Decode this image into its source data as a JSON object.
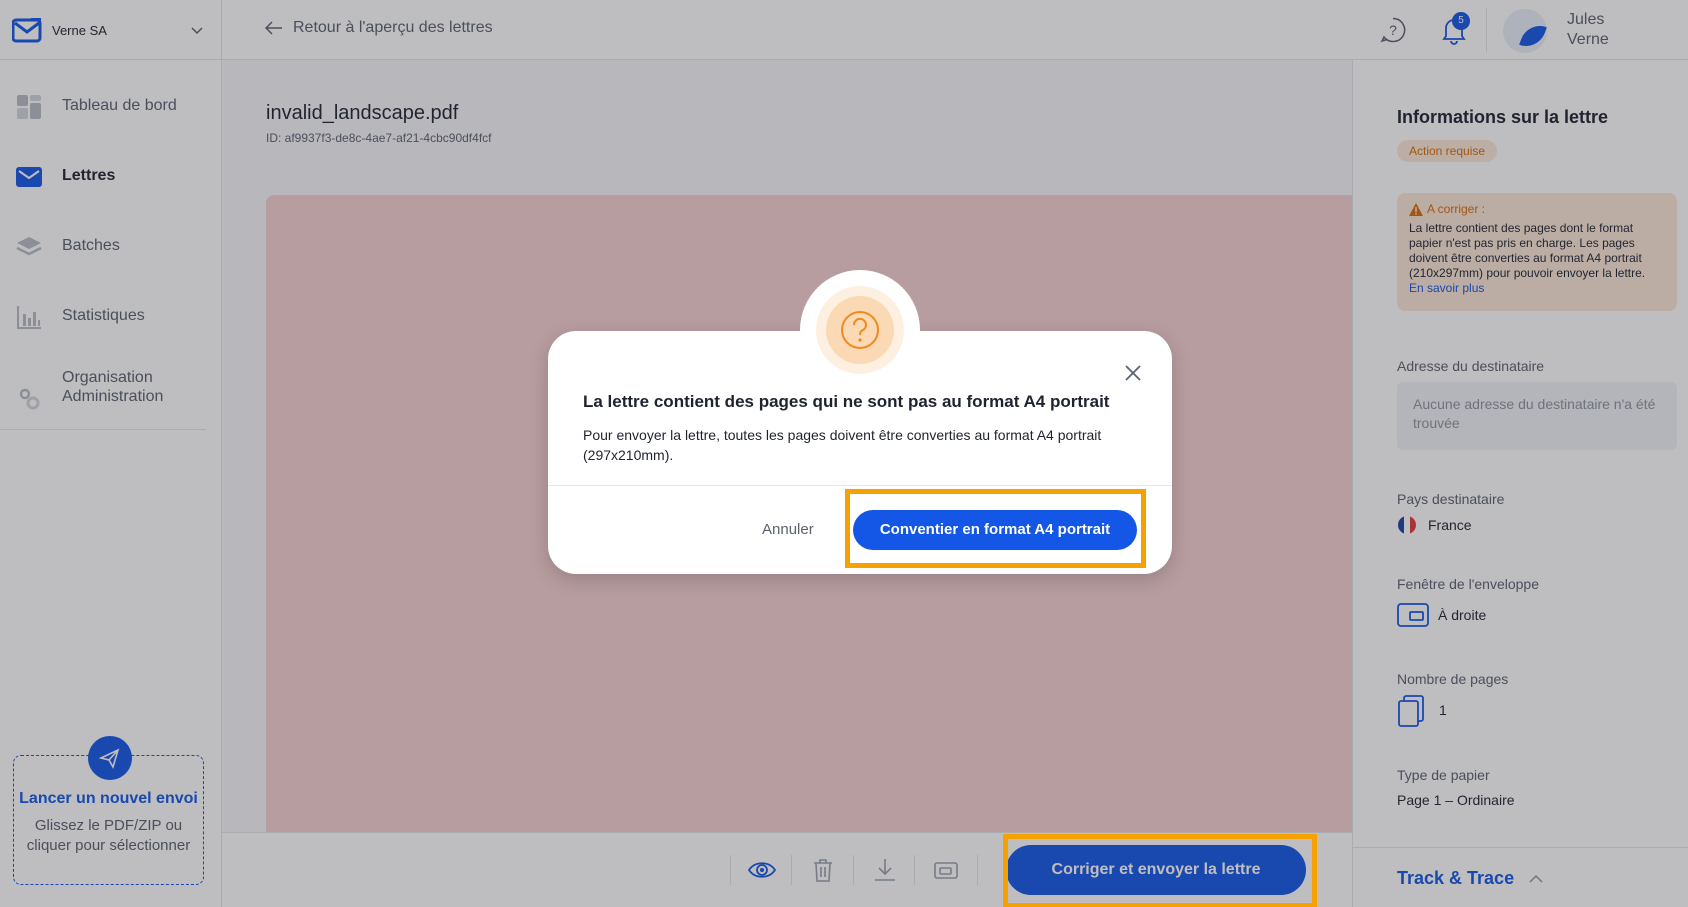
{
  "header": {
    "org_name": "Verne SA",
    "back_label": "Retour à l'aperçu des lettres",
    "notification_count": "5",
    "user_first": "Jules",
    "user_last": "Verne"
  },
  "sidebar": {
    "items": [
      {
        "label": "Tableau de bord",
        "icon": "dashboard-icon"
      },
      {
        "label": "Lettres",
        "icon": "envelope-icon"
      },
      {
        "label": "Batches",
        "icon": "layers-icon"
      },
      {
        "label": "Statistiques",
        "icon": "bar-chart-icon"
      }
    ],
    "admin_line1": "Organisation",
    "admin_line2": "Administration",
    "upload_title": "Lancer un nouvel envoi",
    "upload_sub": "Glissez le PDF/ZIP ou cliquer pour sélectionner"
  },
  "document": {
    "filename": "invalid_landscape.pdf",
    "id": "ID: af9937f3-de8c-4ae7-af21-4cbc90df4fcf"
  },
  "toolbar": {
    "primary_label": "Corriger et envoyer la lettre"
  },
  "info_panel": {
    "title": "Informations sur la lettre",
    "status": "Action requise",
    "warn_title": "A corriger :",
    "warn_text": "La lettre contient des pages dont le format papier n'est pas pris en charge. Les pages doivent être converties au format A4 portrait (210x297mm) pour pouvoir envoyer la lettre.",
    "warn_link": "En savoir plus",
    "address_label": "Adresse du destinataire",
    "address_value": "Aucune adresse du destinataire n'a été trouvée",
    "country_label": "Pays destinataire",
    "country_value": "France",
    "window_label": "Fenêtre de l'enveloppe",
    "window_value": "À droite",
    "pages_label": "Nombre de pages",
    "pages_value": "1",
    "paper_label": "Type de papier",
    "paper_value": "Page 1 – Ordinaire",
    "track_label": "Track & Trace"
  },
  "modal": {
    "title": "La lettre contient des pages qui ne sont pas au format A4 portrait",
    "text": "Pour envoyer la lettre, toutes les pages doivent être converties au format A4 portrait (297x210mm).",
    "cancel_label": "Annuler",
    "confirm_label": "Conventier en format A4 portrait"
  },
  "colors": {
    "accent": "#1456e5",
    "warning": "#d56a09",
    "highlight": "#f5a200",
    "preview_bg": "#f7d0d2"
  }
}
